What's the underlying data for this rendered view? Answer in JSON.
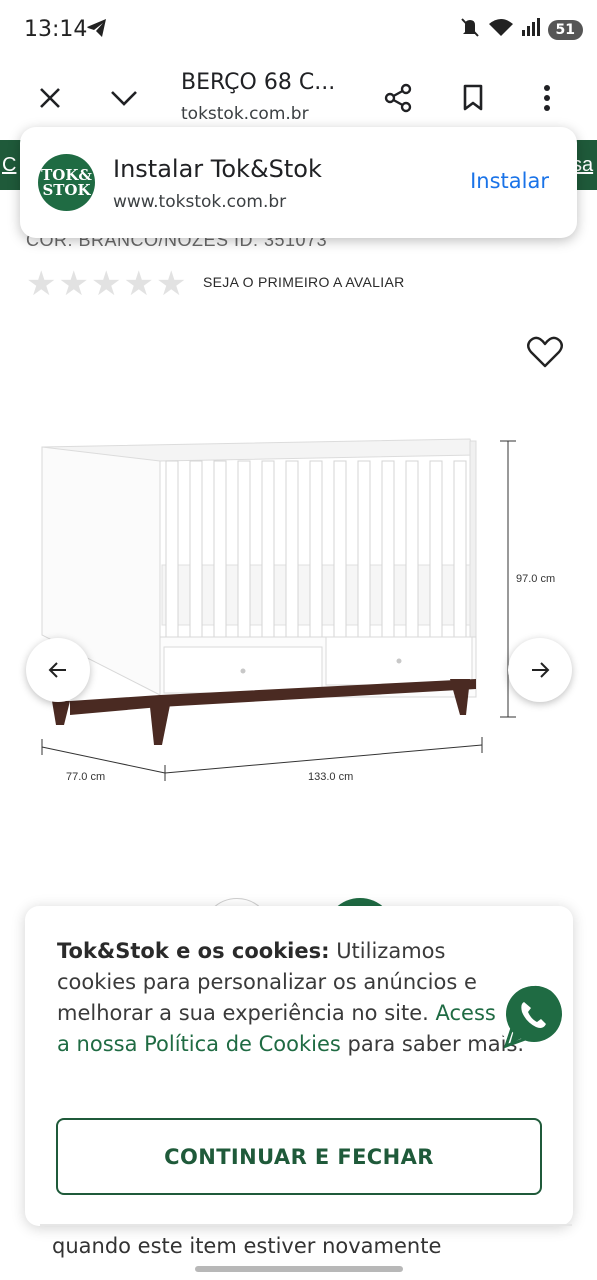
{
  "status_bar": {
    "time": "13:14",
    "battery": "51"
  },
  "toolbar": {
    "title": "BERÇO 68 C...",
    "url": "tokstok.com.br"
  },
  "install_banner": {
    "app_name": "Instalar Tok&Stok",
    "url": "www.tokstok.com.br",
    "button_label": "Instalar",
    "logo_line1": "TOK&",
    "logo_line2": "STOK"
  },
  "page": {
    "greenbar_left": "C",
    "greenbar_right": "sa",
    "meta": "COR: BRANCO/NOZES  ID: 351073",
    "rating_text": "SEJA O PRIMEIRO A AVALIAR",
    "dimensions": {
      "height": "97.0 cm",
      "depth": "77.0 cm",
      "width": "133.0 cm"
    },
    "bottom_fragment": "quando este item estiver novamente"
  },
  "cookie_banner": {
    "bold": "Tok&Stok e os cookies:",
    "text1": " Utilizamos cookies para personalizar os anúncios e melhorar a sua experiência no site. ",
    "link": "Acesse a nossa Política de Cookies",
    "text2": " para saber mais.",
    "button_label": "CONTINUAR E FECHAR"
  },
  "colors": {
    "brand_green": "#1f5a3a",
    "link_blue": "#1a73e8",
    "whatsapp_green": "#1f6b43"
  }
}
